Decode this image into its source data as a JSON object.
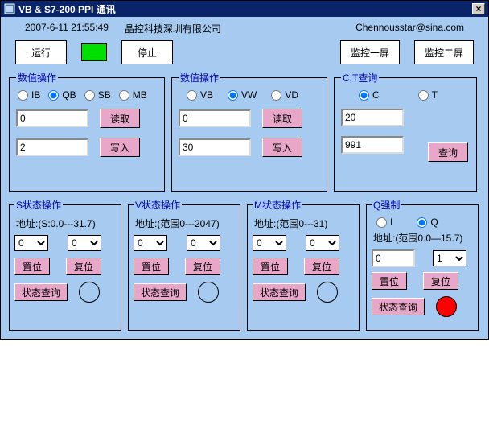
{
  "title": "VB & S7-200 PPI 通讯",
  "info": {
    "datetime": "2007-6-11 21:55:49",
    "company": "晶控科技深圳有限公司",
    "email": "Chennousstar@sina.com"
  },
  "top": {
    "run": "运行",
    "stop": "停止",
    "mon1": "监控一屏",
    "mon2": "监控二屏"
  },
  "num1": {
    "legend": "数值操作",
    "radios": [
      "IB",
      "QB",
      "SB",
      "MB"
    ],
    "read_val": "0",
    "read_btn": "读取",
    "write_val": "2",
    "write_btn": "写入"
  },
  "num2": {
    "legend": "数值操作",
    "radios": [
      "VB",
      "VW",
      "VD"
    ],
    "read_val": "0",
    "read_btn": "读取",
    "write_val": "30",
    "write_btn": "写入"
  },
  "ct": {
    "legend": "C,T查询",
    "radios": [
      "C",
      "T"
    ],
    "val1": "20",
    "query_btn": "查询",
    "val2": "991"
  },
  "s": {
    "legend": "S状态操作",
    "addr": "地址:(S:0.0---31.7)",
    "sel1": "0",
    "sel2": "0",
    "set": "置位",
    "reset": "复位",
    "query": "状态查询"
  },
  "v": {
    "legend": "V状态操作",
    "addr": "地址:(范围0---2047)",
    "sel1": "0",
    "sel2": "0",
    "set": "置位",
    "reset": "复位",
    "query": "状态查询"
  },
  "m": {
    "legend": "M状态操作",
    "addr": "地址:(范围0---31)",
    "sel1": "0",
    "sel2": "0",
    "set": "置位",
    "reset": "复位",
    "query": "状态查询"
  },
  "q": {
    "legend": "Q强制",
    "radios": [
      "I",
      "Q"
    ],
    "addr": "地址:(范围0.0—15.7)",
    "sel1": "0",
    "sel2": "1",
    "set": "置位",
    "reset": "复位",
    "query": "状态查询"
  }
}
